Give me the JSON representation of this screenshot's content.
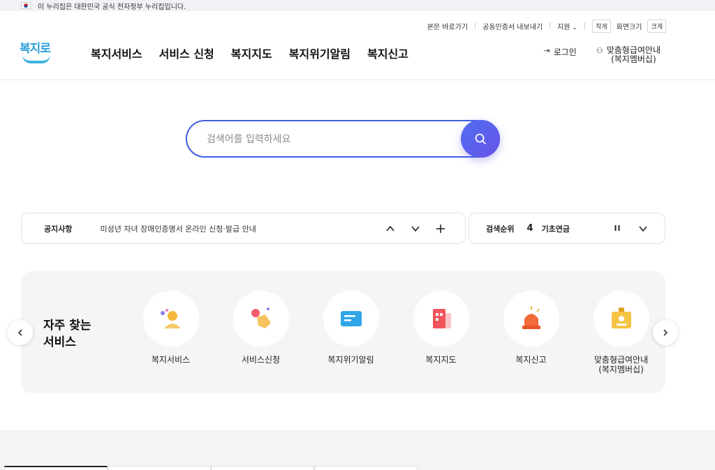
{
  "gov_banner": {
    "text": "이 누리집은 대한민국 공식 전자정부 누리집입니다."
  },
  "utility": {
    "skip": "본문 바로가기",
    "cert": "공동인증서 내보내기",
    "support": "지원",
    "size_small": "작게",
    "size_label": "화면크기",
    "size_large": "크게"
  },
  "logo": {
    "text": "복지로"
  },
  "gnb": [
    "복지서비스",
    "서비스 신청",
    "복지지도",
    "복지위기알림",
    "복지신고"
  ],
  "header_right": {
    "login": "로그인",
    "member_line1": "맞춤형급여안내",
    "member_line2": "(복지멤버십)"
  },
  "search": {
    "placeholder": "검색어를 입력하세요"
  },
  "notice": {
    "label": "공지사항",
    "text": "미성년 자녀 장애인증명서 온라인 신청·발급 안내"
  },
  "rank": {
    "label": "검색순위",
    "number": "4",
    "keyword": "기초연금"
  },
  "favorites": {
    "title_line1": "자주 찾는",
    "title_line2": "서비스",
    "items": [
      {
        "label": "복지서비스",
        "icon": "person-icon",
        "color": "#f6b93b"
      },
      {
        "label": "서비스신청",
        "icon": "hand-touch-icon",
        "color": "#f7c35f"
      },
      {
        "label": "복지위기알림",
        "icon": "message-icon",
        "color": "#2fa6e8"
      },
      {
        "label": "복지지도",
        "icon": "building-icon",
        "color": "#f2545b"
      },
      {
        "label": "복지신고",
        "icon": "siren-icon",
        "color": "#f26b3a"
      },
      {
        "label": "맞춤형급여안내\n(복지멤버십)",
        "icon": "id-card-icon",
        "color": "#f6c445"
      }
    ]
  }
}
